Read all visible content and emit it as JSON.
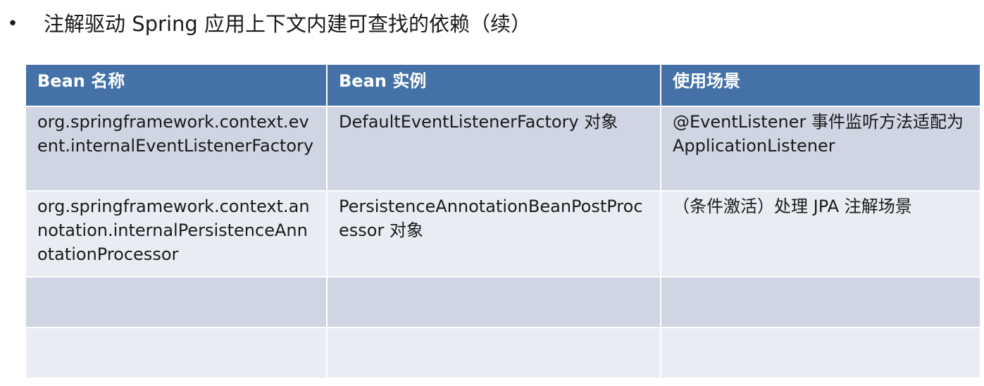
{
  "heading": {
    "bullet": "•",
    "text": "注解驱动 Spring 应用上下文内建可查找的依赖（续）"
  },
  "table": {
    "headers": [
      "Bean 名称",
      "Bean 实例",
      "使用场景"
    ],
    "rows": [
      [
        "org.springframework.context.event.internalEventListenerFactory",
        "DefaultEventListenerFactory 对象",
        "@EventListener 事件监听方法适配为 ApplicationListener"
      ],
      [
        "org.springframework.context.annotation.internalPersistenceAnnotationProcessor",
        "PersistenceAnnotationBeanPostProcessor 对象",
        "（条件激活）处理 JPA 注解场景"
      ],
      [
        "",
        "",
        ""
      ],
      [
        "",
        "",
        ""
      ]
    ]
  },
  "colors": {
    "header_bg": "#4472a8",
    "row_dark": "#cfd5e2",
    "row_light": "#e9ecf2"
  }
}
